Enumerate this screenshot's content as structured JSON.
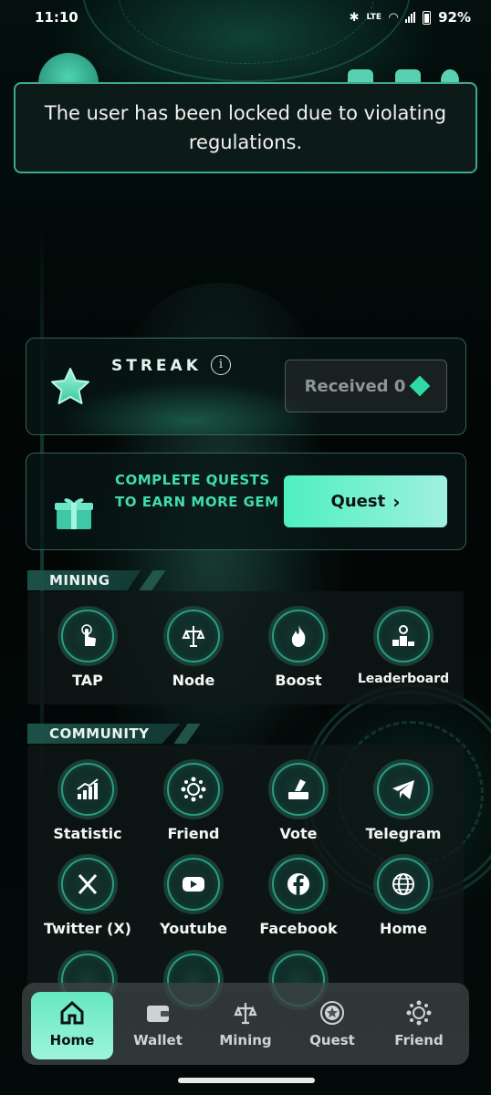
{
  "status_bar": {
    "time": "11:10",
    "network": "LTE",
    "battery": "92%"
  },
  "toast": {
    "message": "The user has been locked due to violating regulations."
  },
  "streak": {
    "title": "STREAK",
    "info_icon": "i",
    "received_label": "Received 0"
  },
  "quest_card": {
    "text": "COMPLETE QUESTS TO EARN MORE GEM",
    "button_label": "Quest"
  },
  "mining": {
    "title": "MINING",
    "items": [
      {
        "label": "TAP",
        "icon": "tap-icon"
      },
      {
        "label": "Node",
        "icon": "node-icon"
      },
      {
        "label": "Boost",
        "icon": "fire-icon"
      },
      {
        "label": "Leaderboard",
        "icon": "podium-icon"
      }
    ]
  },
  "community": {
    "title": "COMMUNITY",
    "items": [
      {
        "label": "Statistic",
        "icon": "chart-icon"
      },
      {
        "label": "Friend",
        "icon": "network-icon"
      },
      {
        "label": "Vote",
        "icon": "vote-icon"
      },
      {
        "label": "Telegram",
        "icon": "telegram-icon"
      },
      {
        "label": "Twitter (X)",
        "icon": "x-icon"
      },
      {
        "label": "Youtube",
        "icon": "youtube-icon"
      },
      {
        "label": "Facebook",
        "icon": "facebook-icon"
      },
      {
        "label": "Home",
        "icon": "globe-icon"
      }
    ]
  },
  "bottom_nav": {
    "items": [
      {
        "label": "Home",
        "icon": "home-icon",
        "active": true
      },
      {
        "label": "Wallet",
        "icon": "wallet-icon"
      },
      {
        "label": "Mining",
        "icon": "mining-icon"
      },
      {
        "label": "Quest",
        "icon": "quest-icon"
      },
      {
        "label": "Friend",
        "icon": "friend-icon"
      }
    ]
  },
  "colors": {
    "accent": "#40dcae",
    "toast_border": "#3fa88e",
    "ring": "#2a9d83"
  }
}
